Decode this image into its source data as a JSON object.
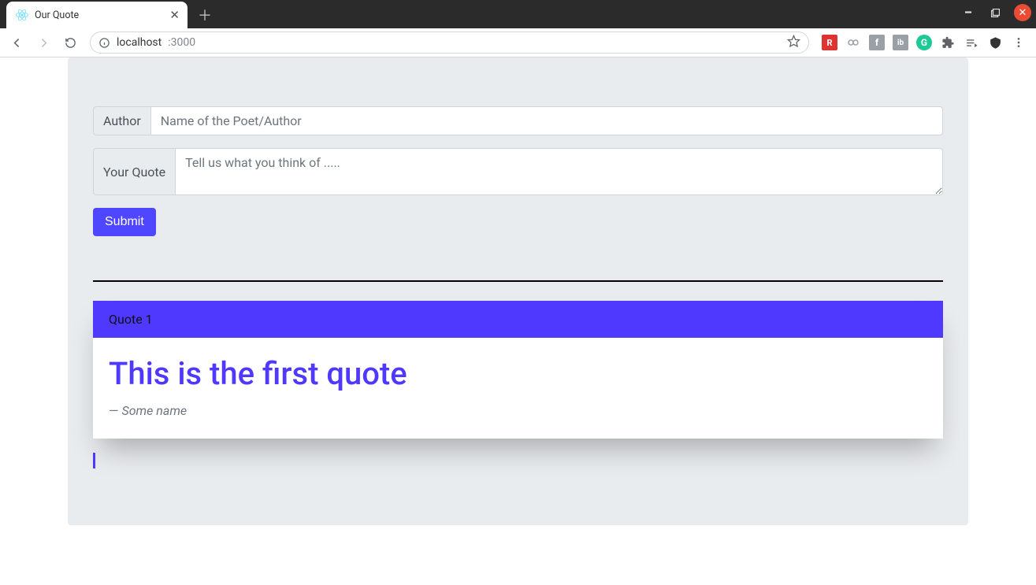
{
  "browser": {
    "tab_title": "Our Quote",
    "url_host": "localhost",
    "url_port": ":3000"
  },
  "form": {
    "author_label": "Author",
    "author_placeholder": "Name of the Poet/Author",
    "quote_label": "Your Quote",
    "quote_placeholder": "Tell us what you think of .....",
    "submit_label": "Submit"
  },
  "quotes": [
    {
      "header": "Quote 1",
      "text": "This is the first quote",
      "author": "Some name"
    }
  ]
}
